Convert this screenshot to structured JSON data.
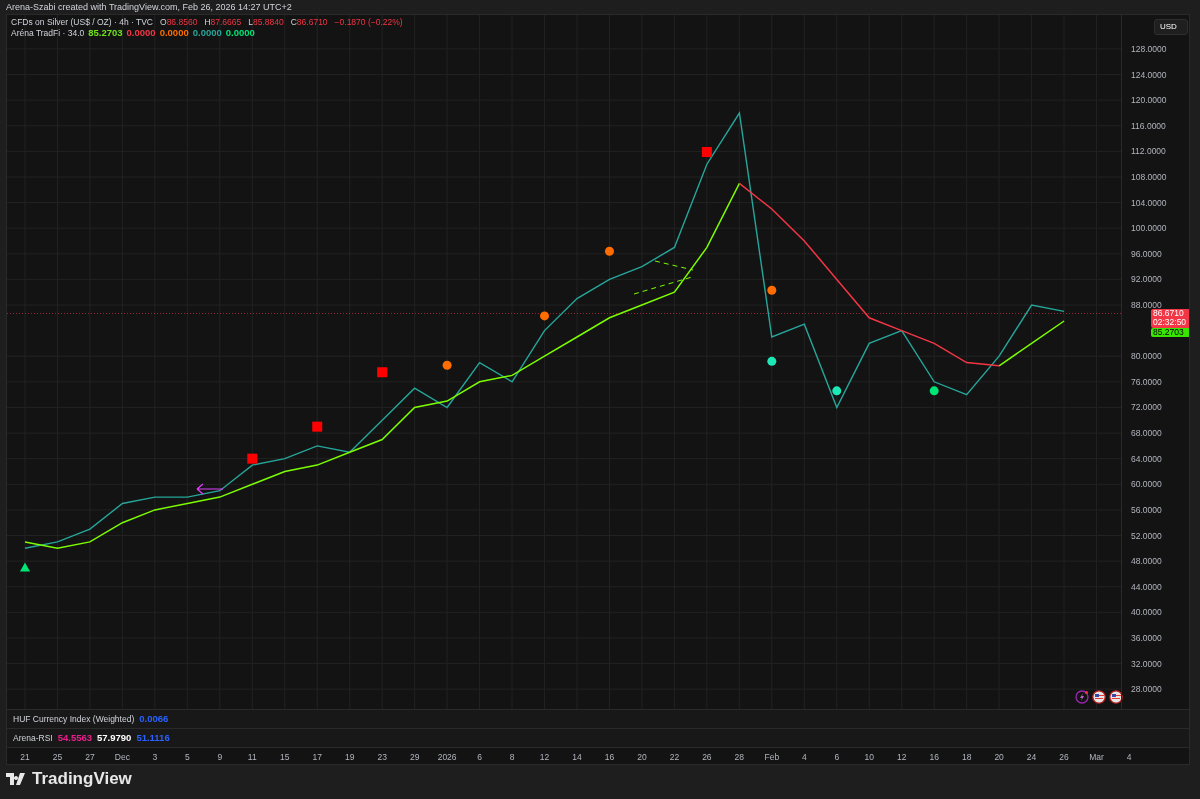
{
  "header": {
    "text": "Arena-Szabi created with TradingView.com, Feb 26, 2026 14:27 UTC+2"
  },
  "legend": {
    "symbol": "CFDs on Silver (US$ / OZ) · 4h · TVC",
    "ohlc": [
      {
        "label": "O",
        "value": "86.8560"
      },
      {
        "label": "H",
        "value": "87.6665"
      },
      {
        "label": "L",
        "value": "85.8840"
      },
      {
        "label": "C",
        "value": "86.6710"
      }
    ],
    "change": "−0.1870 (−0.22%)",
    "indicator": {
      "name": "Aréna TradFi · 34.0",
      "values": [
        {
          "value": "85.2703",
          "color": "#6fe31c"
        },
        {
          "value": "0.0000",
          "color": "#f23645"
        },
        {
          "value": "0.0000",
          "color": "#ff6d00"
        },
        {
          "value": "0.0000",
          "color": "#26a69a"
        },
        {
          "value": "0.0000",
          "color": "#00e676"
        }
      ]
    }
  },
  "currency_button": "USD",
  "price_tags": [
    {
      "kind": "last",
      "value": "86.6710",
      "countdown": "02:32:50",
      "color": "#f23645"
    },
    {
      "kind": "indicator",
      "value": "85.2703",
      "color": "#39e600"
    }
  ],
  "chart": {
    "chart_data": {
      "type": "line",
      "categories": [
        "21",
        "25",
        "27",
        "Dec",
        "3",
        "5",
        "9",
        "11",
        "15",
        "17",
        "19",
        "23",
        "29",
        "2026",
        "6",
        "8",
        "12",
        "14",
        "16",
        "20",
        "22",
        "26",
        "28",
        "Feb",
        "4",
        "6",
        "10",
        "12",
        "16",
        "18",
        "20",
        "24",
        "26",
        "Mar",
        "4"
      ],
      "series": [
        {
          "color": "#26a69a",
          "values": [
            50,
            51,
            53,
            57,
            58,
            58,
            59,
            63,
            64,
            66,
            65,
            70,
            75,
            72,
            79,
            76,
            84,
            89,
            92,
            94,
            97,
            110,
            118,
            83,
            85,
            72,
            82,
            84,
            76,
            74,
            80,
            88,
            87,
            null,
            null
          ]
        },
        {
          "color": "#7cfc00",
          "values": [
            51,
            50,
            51,
            54,
            56,
            57,
            58,
            60,
            62,
            63,
            65,
            67,
            72,
            73,
            76,
            77,
            80,
            83,
            86,
            88,
            90,
            97,
            107,
            null,
            null,
            null,
            null,
            null,
            null,
            null,
            78.5,
            82,
            85.5,
            null,
            null
          ]
        },
        {
          "color": "#f23645",
          "values": [
            null,
            null,
            null,
            null,
            null,
            null,
            null,
            null,
            null,
            null,
            null,
            null,
            null,
            null,
            null,
            null,
            null,
            null,
            null,
            null,
            null,
            null,
            107,
            103,
            98,
            92,
            86,
            84,
            82,
            79,
            78.5,
            null,
            null,
            null,
            null
          ]
        }
      ],
      "ylim": [
        24.9,
        133.3
      ],
      "grid": true,
      "ref_lines": [
        {
          "axis": "y",
          "value": 86.671,
          "color": "#f23645"
        }
      ],
      "yticks": [
        {
          "value": 128,
          "label": "128.0000"
        },
        {
          "value": 124,
          "label": "124.0000"
        },
        {
          "value": 120,
          "label": "120.0000"
        },
        {
          "value": 116,
          "label": "116.0000"
        },
        {
          "value": 112,
          "label": "112.0000"
        },
        {
          "value": 108,
          "label": "108.0000"
        },
        {
          "value": 104,
          "label": "104.0000"
        },
        {
          "value": 100,
          "label": "100.0000"
        },
        {
          "value": 96,
          "label": "96.0000"
        },
        {
          "value": 92,
          "label": "92.0000"
        },
        {
          "value": 88,
          "label": "88.0000"
        },
        {
          "value": 80,
          "label": "80.0000"
        },
        {
          "value": 76,
          "label": "76.0000"
        },
        {
          "value": 72,
          "label": "72.0000"
        },
        {
          "value": 68,
          "label": "68.0000"
        },
        {
          "value": 64,
          "label": "64.0000"
        },
        {
          "value": 60,
          "label": "60.0000"
        },
        {
          "value": 56,
          "label": "56.0000"
        },
        {
          "value": 52,
          "label": "52.0000"
        },
        {
          "value": 48,
          "label": "48.0000"
        },
        {
          "value": 44,
          "label": "44.0000"
        },
        {
          "value": 40,
          "label": "40.0000"
        },
        {
          "value": 36,
          "label": "36.0000"
        },
        {
          "value": 32,
          "label": "32.0000"
        },
        {
          "value": 28,
          "label": "28.0000"
        }
      ]
    }
  },
  "event_icons": [
    {
      "kind": "flash"
    },
    {
      "kind": "flag"
    },
    {
      "kind": "flag"
    }
  ],
  "panes": [
    {
      "name": "HUF Currency Index (Weighted)",
      "values": [
        {
          "value": "0.0066",
          "color": "#2962ff"
        }
      ]
    },
    {
      "name": "Arena-RSI",
      "values": [
        {
          "value": "54.5563",
          "color": "#e91e8c"
        },
        {
          "value": "57.9790",
          "color": "#ffffff"
        },
        {
          "value": "51.1116",
          "color": "#2962ff"
        }
      ]
    }
  ],
  "branding": "TradingView"
}
